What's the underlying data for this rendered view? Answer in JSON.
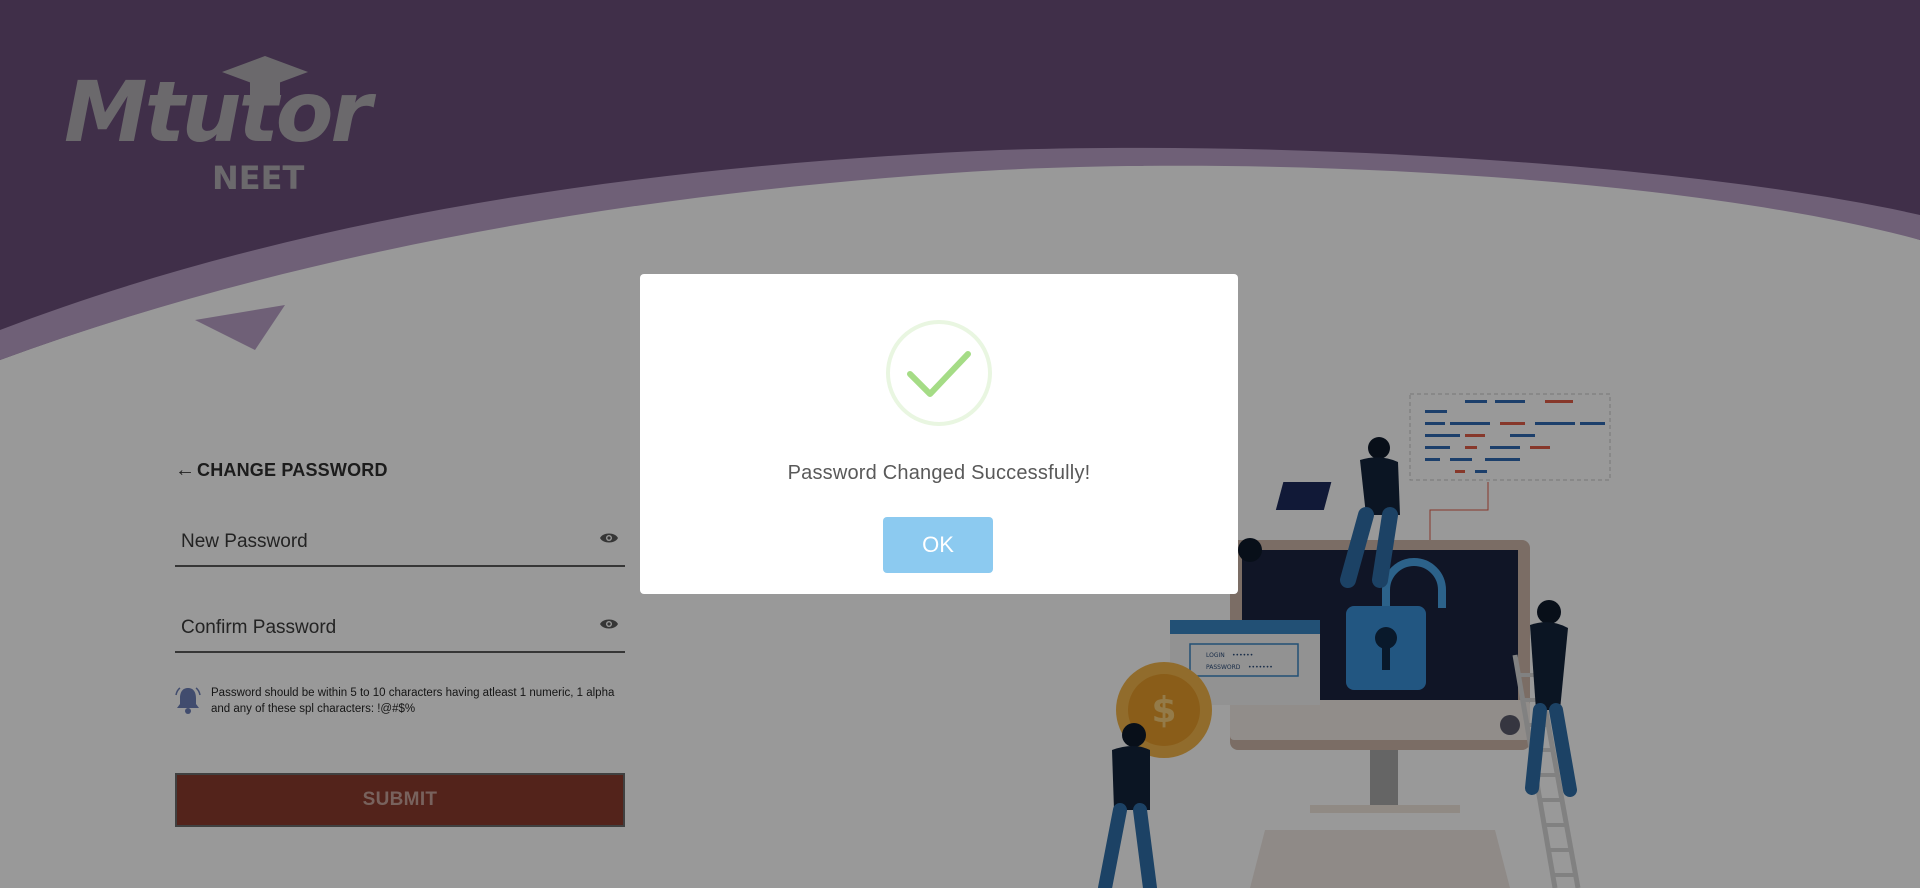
{
  "brand": {
    "logo_main": "Mtutor",
    "logo_sub": "NEET"
  },
  "form": {
    "title": "CHANGE PASSWORD",
    "new_password_label": "New Password",
    "confirm_password_label": "Confirm Password",
    "hint": "Password should be within 5 to 10 characters having atleast 1 numeric, 1 alpha and any of these spl characters: !@#$%",
    "submit_label": "SUBMIT"
  },
  "illustration": {
    "login_label": "LOGIN",
    "login_value": "••••••",
    "password_label": "PASSWORD",
    "password_value": "•••••••"
  },
  "modal": {
    "message": "Password Changed Successfully!",
    "ok_label": "OK"
  },
  "colors": {
    "header_purple": "#6b4f7a",
    "submit_red": "#e15e49",
    "ok_blue": "#8ccaf0",
    "success_green": "#a5dc86"
  },
  "icons": [
    "back-arrow-icon",
    "eye-icon",
    "bell-icon",
    "check-icon"
  ]
}
